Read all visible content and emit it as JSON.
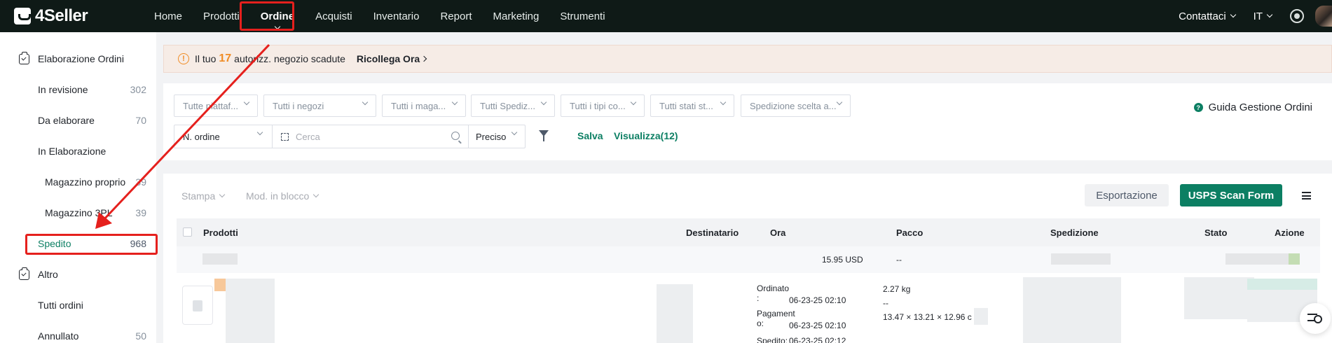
{
  "app": {
    "logo_text": "4Seller"
  },
  "nav": {
    "items": [
      "Home",
      "Prodotti",
      "Ordine",
      "Acquisti",
      "Inventario",
      "Report",
      "Marketing",
      "Strumenti"
    ],
    "active": "Ordine",
    "contact": "Contattaci",
    "language": "IT"
  },
  "sidebar": {
    "group1": "Elaborazione Ordini",
    "items1": [
      {
        "label": "In revisione",
        "count": "302"
      },
      {
        "label": "Da elaborare",
        "count": "70"
      },
      {
        "label": "In Elaborazione",
        "count": ""
      },
      {
        "label": "Magazzino proprio",
        "count": "39"
      },
      {
        "label": "Magazzino 3PL",
        "count": "39"
      },
      {
        "label": "Spedito",
        "count": "968"
      }
    ],
    "group2": "Altro",
    "items2": [
      {
        "label": "Tutti ordini",
        "count": ""
      },
      {
        "label": "Annullato",
        "count": "50"
      }
    ]
  },
  "banner": {
    "prefix": "Il tuo",
    "count": "17",
    "suffix": "autorizz. negozio scadute",
    "action": "Ricollega Ora"
  },
  "filters": {
    "selects": [
      "Tutte piattaf...",
      "Tutti i negozi",
      "Tutti i maga...",
      "Tutti Spediz...",
      "Tutti i tipi co...",
      "Tutti stati st...",
      "Spedizione scelta a..."
    ],
    "guide": "Guida Gestione Ordini",
    "search_type": "N. ordine",
    "search_placeholder": "Cerca",
    "match_mode": "Preciso",
    "save": "Salva",
    "view": "Visualizza(12)"
  },
  "toolbar": {
    "print": "Stampa",
    "bulk_edit": "Mod. in blocco",
    "export": "Esportazione",
    "usps": "USPS Scan Form"
  },
  "table": {
    "columns": [
      "Prodotti",
      "Destinatario",
      "Ora",
      "Pacco",
      "Spedizione",
      "Stato",
      "Azione"
    ],
    "group_amount": "15.95 USD",
    "group_package": "--",
    "row": {
      "ordered_label": "Ordinato\n:",
      "ordered_value": "06-23-25 02:10",
      "paid_label": "Pagament\no:",
      "paid_value": "06-23-25 02:10",
      "shipped_label": "Spedito:",
      "shipped_value": "06-23-25 02:12",
      "weight": "2.27 kg",
      "weight_sub": "--",
      "dimensions": "13.47 × 13.21 × 12.96 c"
    }
  },
  "colors": {
    "brand": "#0c7f63",
    "nav_bg": "#0f1a17",
    "highlight": "#e5201d",
    "warning": "#f08c25"
  }
}
